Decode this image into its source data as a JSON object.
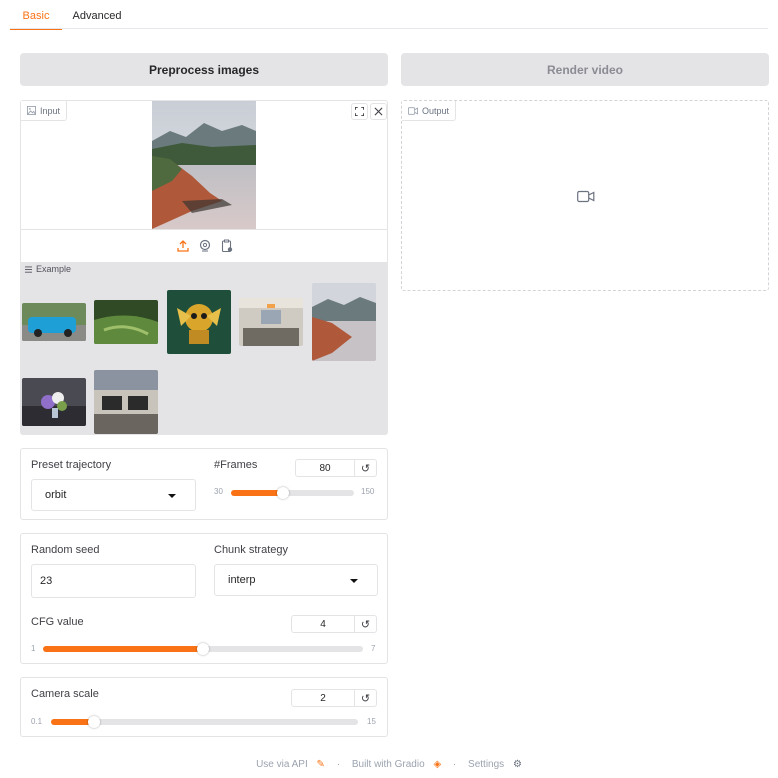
{
  "tabs": [
    {
      "label": "Basic",
      "active": true
    },
    {
      "label": "Advanced",
      "active": false
    }
  ],
  "buttons": {
    "preprocess": "Preprocess images",
    "render": "Render video"
  },
  "input_panel": {
    "label": "Input",
    "icons": [
      "fullscreen-icon",
      "close-icon",
      "upload-icon",
      "webcam-icon",
      "clipboard-icon"
    ]
  },
  "output_panel": {
    "label": "Output",
    "icon": "video-camera-icon"
  },
  "examples": {
    "label": "Example",
    "items": [
      "blue car",
      "terraced valley",
      "dragon figurine",
      "office room",
      "mountain lake",
      "flower vase",
      "office desks"
    ]
  },
  "trajectory": {
    "preset_label": "Preset trajectory",
    "preset_value": "orbit",
    "frames_label": "#Frames",
    "frames_value": "80",
    "frames_min": "30",
    "frames_max": "150",
    "frames_fraction": 0.42
  },
  "sampling": {
    "seed_label": "Random seed",
    "seed_value": "23",
    "chunk_label": "Chunk strategy",
    "chunk_value": "interp",
    "cfg_label": "CFG value",
    "cfg_value": "4",
    "cfg_min": "1",
    "cfg_max": "7",
    "cfg_fraction": 0.5
  },
  "camera": {
    "scale_label": "Camera scale",
    "scale_value": "2",
    "scale_min": "0.1",
    "scale_max": "15",
    "scale_fraction": 0.14
  },
  "footer": {
    "api": "Use via API",
    "built": "Built with Gradio",
    "settings": "Settings",
    "separator": "·"
  },
  "colors": {
    "accent": "#f97316",
    "button_bg": "#e4e4e7"
  }
}
